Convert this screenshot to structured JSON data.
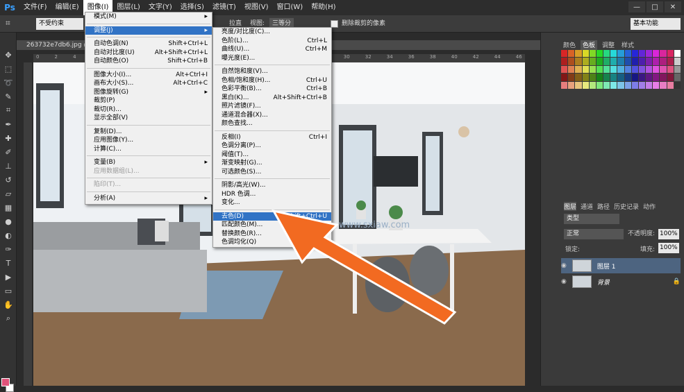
{
  "menubar": {
    "logo": "Ps",
    "items": [
      "文件(F)",
      "编辑(E)",
      "图像(I)",
      "图层(L)",
      "文字(Y)",
      "选择(S)",
      "滤镜(T)",
      "视图(V)",
      "窗口(W)",
      "帮助(H)"
    ]
  },
  "window_controls": [
    "—",
    "□",
    "✕"
  ],
  "options": {
    "ratio": "不受约束",
    "straighten": "拉直",
    "view_label": "视图:",
    "view_value": "三等分",
    "delete_crop": "删除裁剪的像素",
    "workspace": "基本功能"
  },
  "document_tab": "263732e7db6.jpg @ 100%",
  "ruler_ticks": [
    "0",
    "2",
    "4",
    "6",
    "8",
    "10",
    "12",
    "14",
    "16",
    "18",
    "20",
    "22",
    "24",
    "26",
    "28",
    "30",
    "32",
    "34",
    "36",
    "38",
    "40",
    "42",
    "44",
    "46"
  ],
  "image_menu": [
    {
      "label": "模式(M)",
      "shortcut": "",
      "sub": true
    },
    {
      "sep": true
    },
    {
      "label": "调整(J)",
      "shortcut": "",
      "sub": true,
      "hl": true
    },
    {
      "sep": true
    },
    {
      "label": "自动色调(N)",
      "shortcut": "Shift+Ctrl+L"
    },
    {
      "label": "自动对比度(U)",
      "shortcut": "Alt+Shift+Ctrl+L"
    },
    {
      "label": "自动颜色(O)",
      "shortcut": "Shift+Ctrl+B"
    },
    {
      "sep": true
    },
    {
      "label": "图像大小(I)...",
      "shortcut": "Alt+Ctrl+I"
    },
    {
      "label": "画布大小(S)...",
      "shortcut": "Alt+Ctrl+C"
    },
    {
      "label": "图像旋转(G)",
      "shortcut": "",
      "sub": true
    },
    {
      "label": "裁剪(P)",
      "shortcut": ""
    },
    {
      "label": "裁切(R)...",
      "shortcut": ""
    },
    {
      "label": "显示全部(V)",
      "shortcut": ""
    },
    {
      "sep": true
    },
    {
      "label": "复制(D)...",
      "shortcut": ""
    },
    {
      "label": "应用图像(Y)...",
      "shortcut": ""
    },
    {
      "label": "计算(C)...",
      "shortcut": ""
    },
    {
      "sep": true
    },
    {
      "label": "变量(B)",
      "shortcut": "",
      "sub": true
    },
    {
      "label": "应用数据组(L)...",
      "shortcut": "",
      "dis": true
    },
    {
      "sep": true
    },
    {
      "label": "陷印(T)...",
      "shortcut": "",
      "dis": true
    },
    {
      "sep": true
    },
    {
      "label": "分析(A)",
      "shortcut": "",
      "sub": true
    }
  ],
  "adjust_menu": [
    {
      "label": "亮度/对比度(C)...",
      "shortcut": ""
    },
    {
      "label": "色阶(L)...",
      "shortcut": "Ctrl+L"
    },
    {
      "label": "曲线(U)...",
      "shortcut": "Ctrl+M"
    },
    {
      "label": "曝光度(E)...",
      "shortcut": ""
    },
    {
      "sep": true
    },
    {
      "label": "自然饱和度(V)...",
      "shortcut": ""
    },
    {
      "label": "色相/饱和度(H)...",
      "shortcut": "Ctrl+U"
    },
    {
      "label": "色彩平衡(B)...",
      "shortcut": "Ctrl+B"
    },
    {
      "label": "黑白(K)...",
      "shortcut": "Alt+Shift+Ctrl+B"
    },
    {
      "label": "照片滤镜(F)...",
      "shortcut": ""
    },
    {
      "label": "通道混合器(X)...",
      "shortcut": ""
    },
    {
      "label": "颜色查找...",
      "shortcut": ""
    },
    {
      "sep": true
    },
    {
      "label": "反相(I)",
      "shortcut": "Ctrl+I"
    },
    {
      "label": "色调分离(P)...",
      "shortcut": ""
    },
    {
      "label": "阈值(T)...",
      "shortcut": ""
    },
    {
      "label": "渐变映射(G)...",
      "shortcut": ""
    },
    {
      "label": "可选颜色(S)...",
      "shortcut": ""
    },
    {
      "sep": true
    },
    {
      "label": "阴影/高光(W)...",
      "shortcut": ""
    },
    {
      "label": "HDR 色调...",
      "shortcut": ""
    },
    {
      "label": "变化...",
      "shortcut": ""
    },
    {
      "sep": true
    },
    {
      "label": "去色(D)",
      "shortcut": "Shift+Ctrl+U",
      "hl": true
    },
    {
      "label": "匹配颜色(M)...",
      "shortcut": ""
    },
    {
      "label": "替换颜色(R)...",
      "shortcut": ""
    },
    {
      "label": "色调均化(Q)",
      "shortcut": ""
    }
  ],
  "panels": {
    "swatch_tabs": [
      "颜色",
      "色板",
      "调整",
      "样式"
    ],
    "layer_tabs": [
      "图层",
      "通道",
      "路径",
      "历史记录",
      "动作"
    ],
    "kind": "类型",
    "blend": "正常",
    "opacity_label": "不透明度:",
    "opacity": "100%",
    "lock_label": "锁定:",
    "fill_label": "填充:",
    "fill": "100%",
    "layers": [
      "图层 1",
      "背景"
    ]
  },
  "watermark": "www.sxiaw.com",
  "colors": {
    "highlight": "#3173c5",
    "arrow": "#f26a21",
    "fg": "#e0527a"
  }
}
